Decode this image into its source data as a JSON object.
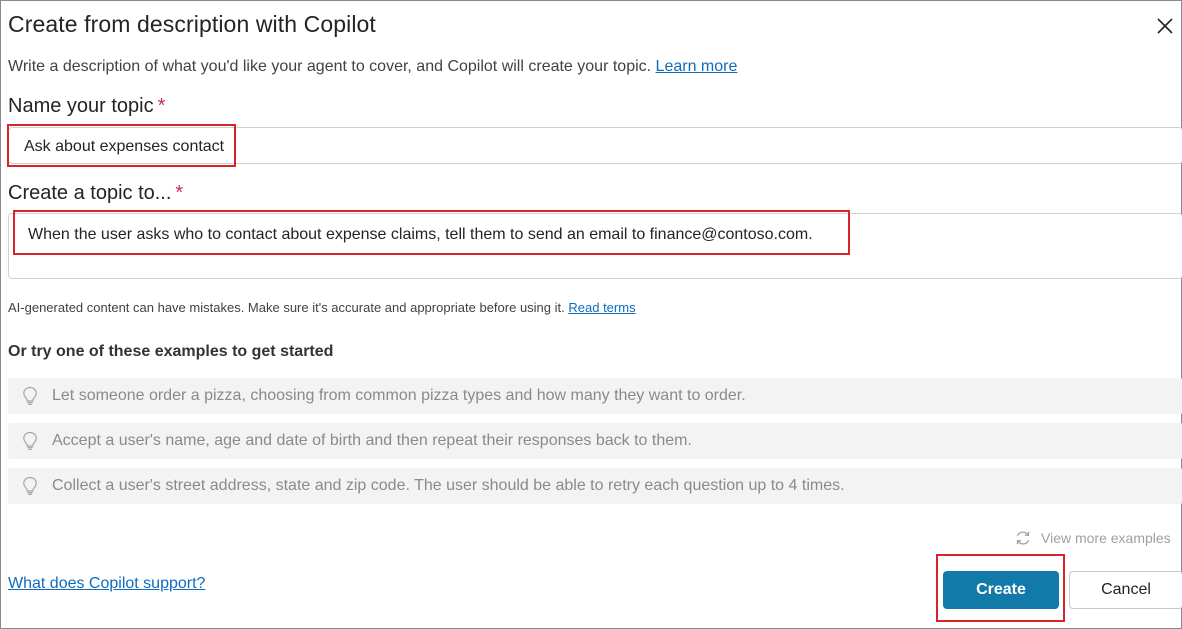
{
  "dialog": {
    "title": "Create from description with Copilot",
    "close_icon": "close-icon",
    "description": "Write a description of what you'd like your agent to cover, and Copilot will create your topic.",
    "learn_more": "Learn more"
  },
  "name_field": {
    "label": "Name your topic",
    "required_mark": "*",
    "value": "Ask about expenses contact"
  },
  "topic_field": {
    "label": "Create a topic to...",
    "required_mark": "*",
    "value": "When the user asks who to contact about expense claims, tell them to send an email to finance@contoso.com."
  },
  "disclaimer": {
    "text": "AI-generated content can have mistakes. Make sure it's accurate and appropriate before using it.",
    "link": "Read terms"
  },
  "examples": {
    "heading": "Or try one of these examples to get started",
    "icon": "lightbulb-icon",
    "items": [
      "Let someone order a pizza, choosing from common pizza types and how many they want to order.",
      "Accept a user's name, age and date of birth and then repeat their responses back to them.",
      "Collect a user's street address, state and zip code. The user should be able to retry each question up to 4 times."
    ],
    "view_more": "View more examples",
    "view_more_icon": "refresh-icon"
  },
  "footer": {
    "support_link": "What does Copilot support?",
    "create_label": "Create",
    "cancel_label": "Cancel"
  },
  "colors": {
    "primary": "#117aa9",
    "link": "#0f6cbd",
    "required": "#c4314b",
    "highlight": "#d6242a",
    "example_bg": "#f3f3f3"
  }
}
